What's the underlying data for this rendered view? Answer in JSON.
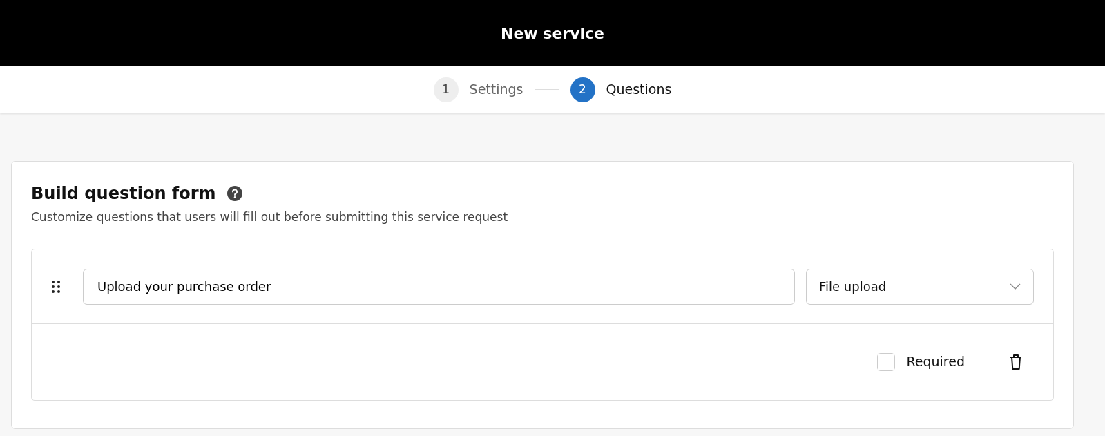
{
  "header": {
    "title": "New service"
  },
  "steps": [
    {
      "number": "1",
      "label": "Settings",
      "selected": false
    },
    {
      "number": "2",
      "label": "Questions",
      "selected": true
    }
  ],
  "form": {
    "title": "Build question form",
    "subtitle": "Customize questions that users will fill out before submitting this service request",
    "questions": [
      {
        "text": "Upload your purchase order",
        "type": "File upload",
        "required": false,
        "required_label": "Required"
      }
    ]
  }
}
